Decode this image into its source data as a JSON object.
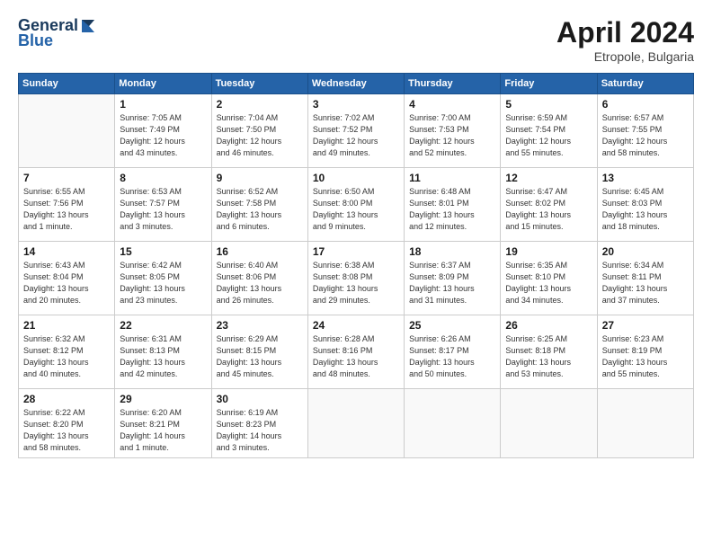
{
  "header": {
    "logo_general": "General",
    "logo_blue": "Blue",
    "month_title": "April 2024",
    "location": "Etropole, Bulgaria"
  },
  "weekdays": [
    "Sunday",
    "Monday",
    "Tuesday",
    "Wednesday",
    "Thursday",
    "Friday",
    "Saturday"
  ],
  "weeks": [
    [
      {
        "day": "",
        "info": ""
      },
      {
        "day": "1",
        "info": "Sunrise: 7:05 AM\nSunset: 7:49 PM\nDaylight: 12 hours\nand 43 minutes."
      },
      {
        "day": "2",
        "info": "Sunrise: 7:04 AM\nSunset: 7:50 PM\nDaylight: 12 hours\nand 46 minutes."
      },
      {
        "day": "3",
        "info": "Sunrise: 7:02 AM\nSunset: 7:52 PM\nDaylight: 12 hours\nand 49 minutes."
      },
      {
        "day": "4",
        "info": "Sunrise: 7:00 AM\nSunset: 7:53 PM\nDaylight: 12 hours\nand 52 minutes."
      },
      {
        "day": "5",
        "info": "Sunrise: 6:59 AM\nSunset: 7:54 PM\nDaylight: 12 hours\nand 55 minutes."
      },
      {
        "day": "6",
        "info": "Sunrise: 6:57 AM\nSunset: 7:55 PM\nDaylight: 12 hours\nand 58 minutes."
      }
    ],
    [
      {
        "day": "7",
        "info": "Sunrise: 6:55 AM\nSunset: 7:56 PM\nDaylight: 13 hours\nand 1 minute."
      },
      {
        "day": "8",
        "info": "Sunrise: 6:53 AM\nSunset: 7:57 PM\nDaylight: 13 hours\nand 3 minutes."
      },
      {
        "day": "9",
        "info": "Sunrise: 6:52 AM\nSunset: 7:58 PM\nDaylight: 13 hours\nand 6 minutes."
      },
      {
        "day": "10",
        "info": "Sunrise: 6:50 AM\nSunset: 8:00 PM\nDaylight: 13 hours\nand 9 minutes."
      },
      {
        "day": "11",
        "info": "Sunrise: 6:48 AM\nSunset: 8:01 PM\nDaylight: 13 hours\nand 12 minutes."
      },
      {
        "day": "12",
        "info": "Sunrise: 6:47 AM\nSunset: 8:02 PM\nDaylight: 13 hours\nand 15 minutes."
      },
      {
        "day": "13",
        "info": "Sunrise: 6:45 AM\nSunset: 8:03 PM\nDaylight: 13 hours\nand 18 minutes."
      }
    ],
    [
      {
        "day": "14",
        "info": "Sunrise: 6:43 AM\nSunset: 8:04 PM\nDaylight: 13 hours\nand 20 minutes."
      },
      {
        "day": "15",
        "info": "Sunrise: 6:42 AM\nSunset: 8:05 PM\nDaylight: 13 hours\nand 23 minutes."
      },
      {
        "day": "16",
        "info": "Sunrise: 6:40 AM\nSunset: 8:06 PM\nDaylight: 13 hours\nand 26 minutes."
      },
      {
        "day": "17",
        "info": "Sunrise: 6:38 AM\nSunset: 8:08 PM\nDaylight: 13 hours\nand 29 minutes."
      },
      {
        "day": "18",
        "info": "Sunrise: 6:37 AM\nSunset: 8:09 PM\nDaylight: 13 hours\nand 31 minutes."
      },
      {
        "day": "19",
        "info": "Sunrise: 6:35 AM\nSunset: 8:10 PM\nDaylight: 13 hours\nand 34 minutes."
      },
      {
        "day": "20",
        "info": "Sunrise: 6:34 AM\nSunset: 8:11 PM\nDaylight: 13 hours\nand 37 minutes."
      }
    ],
    [
      {
        "day": "21",
        "info": "Sunrise: 6:32 AM\nSunset: 8:12 PM\nDaylight: 13 hours\nand 40 minutes."
      },
      {
        "day": "22",
        "info": "Sunrise: 6:31 AM\nSunset: 8:13 PM\nDaylight: 13 hours\nand 42 minutes."
      },
      {
        "day": "23",
        "info": "Sunrise: 6:29 AM\nSunset: 8:15 PM\nDaylight: 13 hours\nand 45 minutes."
      },
      {
        "day": "24",
        "info": "Sunrise: 6:28 AM\nSunset: 8:16 PM\nDaylight: 13 hours\nand 48 minutes."
      },
      {
        "day": "25",
        "info": "Sunrise: 6:26 AM\nSunset: 8:17 PM\nDaylight: 13 hours\nand 50 minutes."
      },
      {
        "day": "26",
        "info": "Sunrise: 6:25 AM\nSunset: 8:18 PM\nDaylight: 13 hours\nand 53 minutes."
      },
      {
        "day": "27",
        "info": "Sunrise: 6:23 AM\nSunset: 8:19 PM\nDaylight: 13 hours\nand 55 minutes."
      }
    ],
    [
      {
        "day": "28",
        "info": "Sunrise: 6:22 AM\nSunset: 8:20 PM\nDaylight: 13 hours\nand 58 minutes."
      },
      {
        "day": "29",
        "info": "Sunrise: 6:20 AM\nSunset: 8:21 PM\nDaylight: 14 hours\nand 1 minute."
      },
      {
        "day": "30",
        "info": "Sunrise: 6:19 AM\nSunset: 8:23 PM\nDaylight: 14 hours\nand 3 minutes."
      },
      {
        "day": "",
        "info": ""
      },
      {
        "day": "",
        "info": ""
      },
      {
        "day": "",
        "info": ""
      },
      {
        "day": "",
        "info": ""
      }
    ]
  ]
}
